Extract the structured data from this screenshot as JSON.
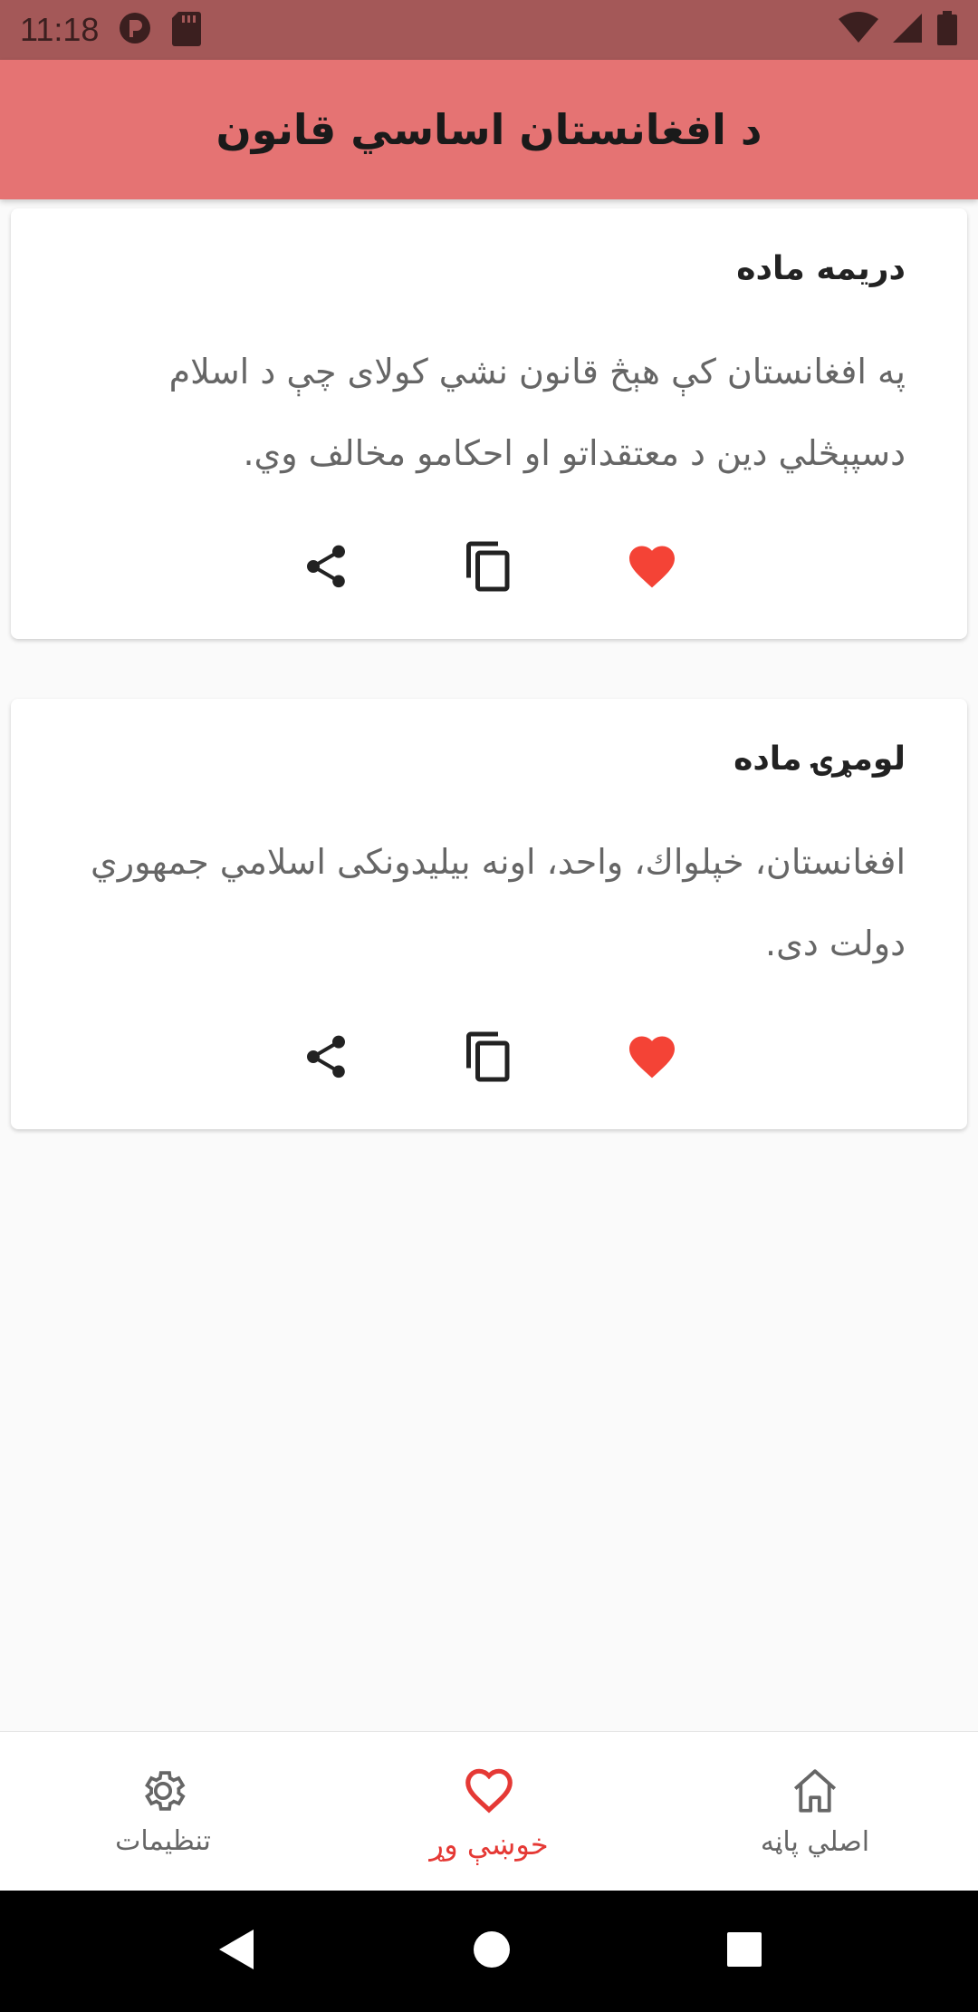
{
  "status_bar": {
    "time": "11:18",
    "icons": [
      "media-icon",
      "sd-card-icon",
      "wifi-icon",
      "signal-icon",
      "battery-icon"
    ]
  },
  "app_bar": {
    "title": "د افغانستان اساسي قانون"
  },
  "cards": [
    {
      "title": "دریمه ماده",
      "body": "په افغانستان کې هېڅ قانون نشي کولای چې د اسلام دسپېڅلي دین د معتقداتو او احکامو مخالف وي.",
      "actions": [
        "share-icon",
        "copy-icon",
        "heart-icon"
      ]
    },
    {
      "title": "لومړۍ ماده",
      "body": "افغانستان، خپلواك، واحد، اونه بیلیدونکی اسلامي جمهوري دولت دی.",
      "actions": [
        "share-icon",
        "copy-icon",
        "heart-icon"
      ]
    }
  ],
  "bottom_nav": {
    "items": [
      {
        "label": "تنظیمات",
        "icon": "gear-icon",
        "active": false
      },
      {
        "label": "خوښې وړ",
        "icon": "heart-outline-icon",
        "active": true
      },
      {
        "label": "اصلي پاڼه",
        "icon": "home-icon",
        "active": false
      }
    ]
  },
  "colors": {
    "status_bar": "#a45858",
    "app_bar": "#e57373",
    "accent": "#e53935",
    "heart": "#f44336"
  }
}
